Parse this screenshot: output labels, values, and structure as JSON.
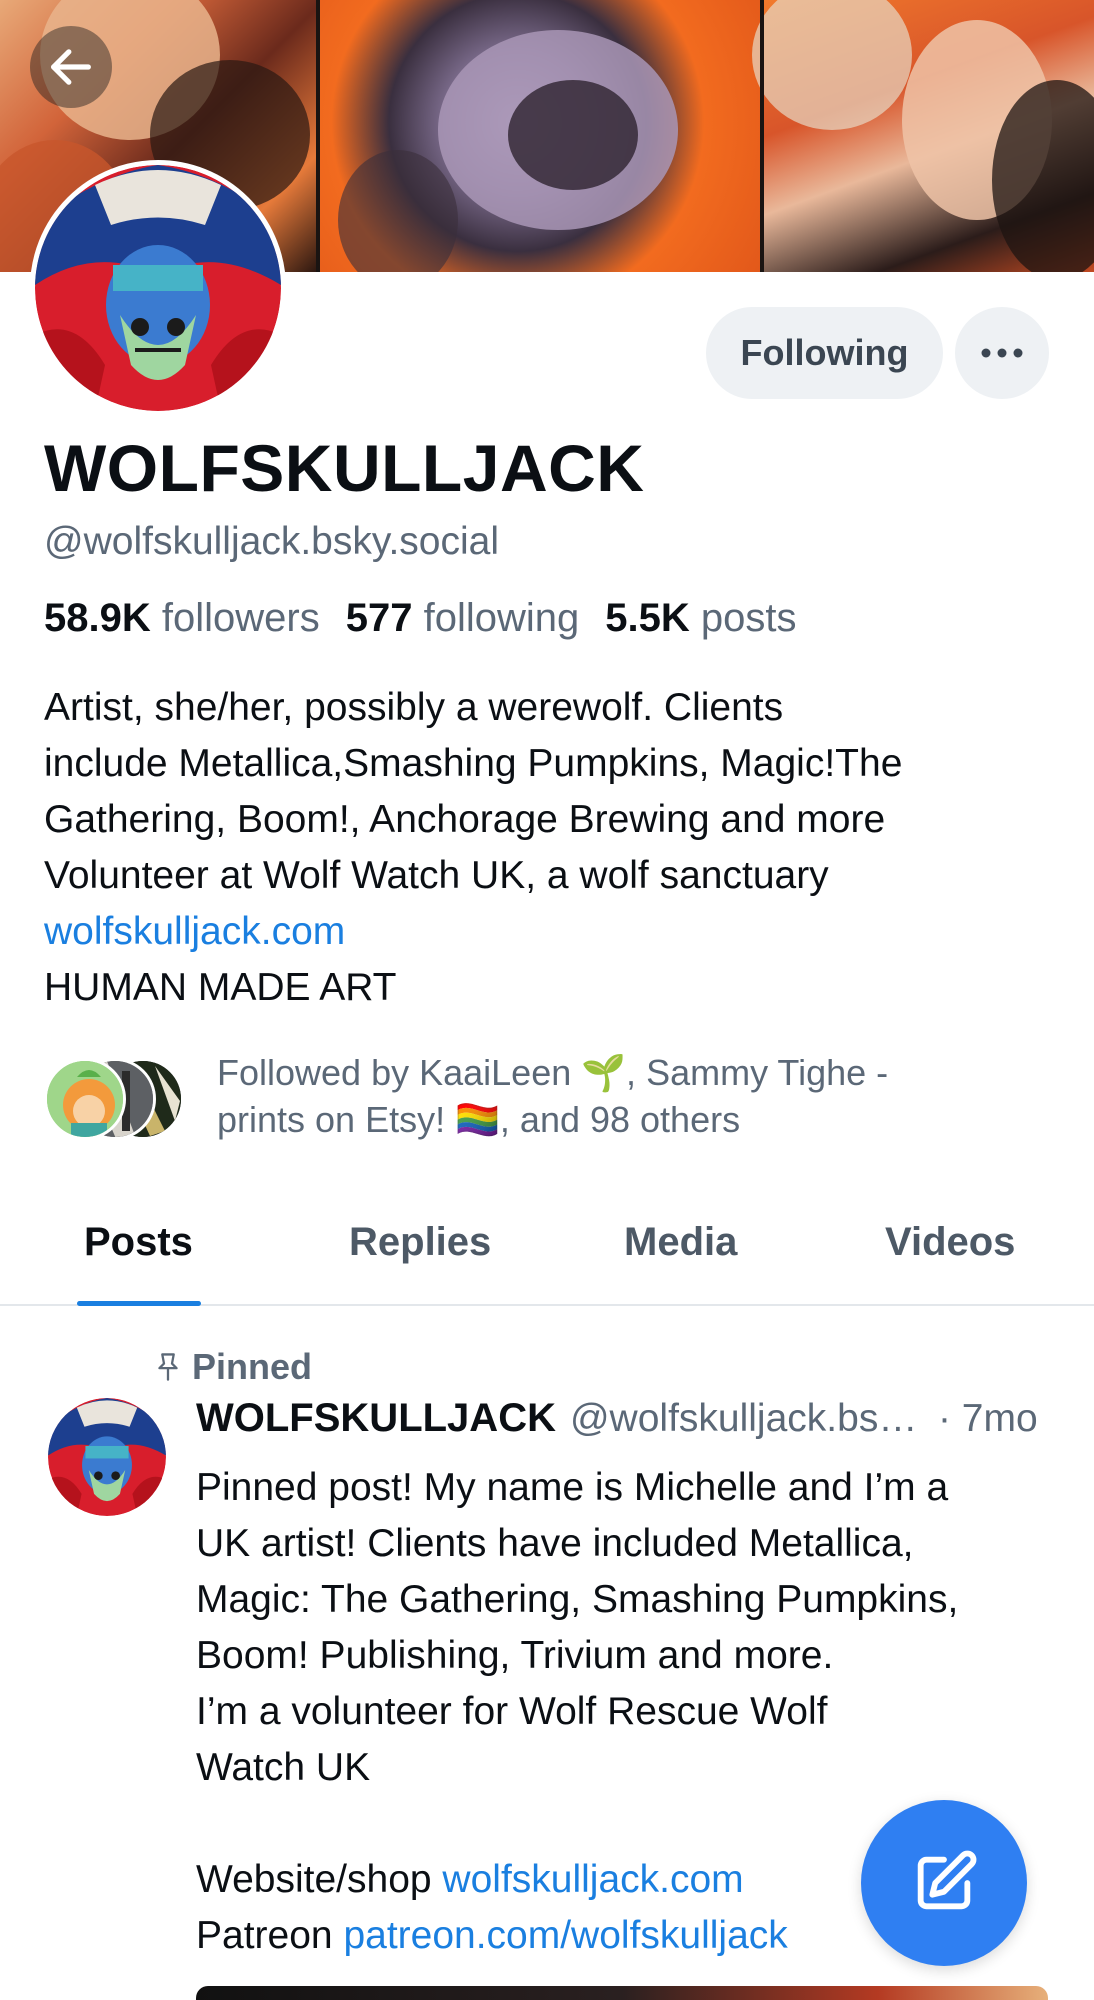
{
  "profile": {
    "display_name": "WOLFSKULLJACK",
    "handle": "@wolfskulljack.bsky.social",
    "follow_button_label": "Following",
    "stats": {
      "followers_count": "58.9K",
      "followers_label": "followers",
      "following_count": "577",
      "following_label": "following",
      "posts_count": "5.5K",
      "posts_label": "posts"
    },
    "bio_lines": [
      "Artist, she/her, possibly a werewolf. Clients",
      "include Metallica,Smashing Pumpkins, Magic!The",
      "Gathering, Boom!, Anchorage Brewing and more",
      "Volunteer at Wolf Watch UK, a wolf sanctuary"
    ],
    "bio_link": "wolfskulljack.com",
    "bio_tail": "HUMAN MADE ART",
    "followed_by_line1": "Followed by KaaiLeen 🌱, Sammy Tighe -",
    "followed_by_line2": "prints on Etsy! 🏳️‍🌈, and 98 others"
  },
  "tabs": [
    {
      "label": "Posts",
      "active": true
    },
    {
      "label": "Replies",
      "active": false
    },
    {
      "label": "Media",
      "active": false
    },
    {
      "label": "Videos",
      "active": false
    }
  ],
  "pinned_post": {
    "pinned_label": "Pinned",
    "author_name": "WOLFSKULLJACK",
    "author_handle": "@wolfskulljack.bsky.social",
    "time": "· 7mo",
    "text_lines": [
      "Pinned post! My name is Michelle and I’m a",
      "UK artist! Clients have included Metallica,",
      "Magic: The Gathering, Smashing Pumpkins,",
      "Boom! Publishing, Trivium and more.",
      "I’m a volunteer for Wolf Rescue Wolf",
      "Watch UK"
    ],
    "website_prefix": "Website/shop ",
    "website_link": "wolfskulljack.com",
    "patreon_prefix": "Patreon ",
    "patreon_link": "patreon.com/wolfskulljack"
  },
  "icons": {
    "back": "arrow-left-icon",
    "more": "ellipsis-icon",
    "pin": "pin-icon",
    "compose": "compose-icon"
  },
  "colors": {
    "accent": "#1a7fe0",
    "fab": "#2f7ff2",
    "muted_text": "#5b6877",
    "button_bg": "#eef1f4"
  }
}
